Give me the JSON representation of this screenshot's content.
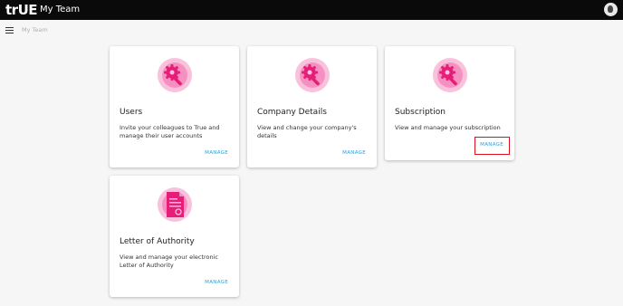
{
  "header": {
    "logo_text": "trUE",
    "title": "My Team"
  },
  "breadcrumb": {
    "current": "My Team"
  },
  "cards": [
    {
      "title": "Users",
      "description": "Invite your colleagues to True and manage their user accounts",
      "action": "MANAGE",
      "icon": "settings-wrench-icon"
    },
    {
      "title": "Company Details",
      "description": "View and change your company's details",
      "action": "MANAGE",
      "icon": "settings-wrench-icon"
    },
    {
      "title": "Subscription",
      "description": "View and manage your subscription",
      "action": "MANAGE",
      "icon": "settings-wrench-icon"
    },
    {
      "title": "Letter of Authority",
      "description": "View and manage your electronic Letter of Authority",
      "action": "MANAGE",
      "icon": "document-icon"
    }
  ],
  "colors": {
    "accent": "#e61e78",
    "link": "#2aa3d6",
    "header_bg": "#0a0a0a",
    "highlight": "#e0101a"
  }
}
